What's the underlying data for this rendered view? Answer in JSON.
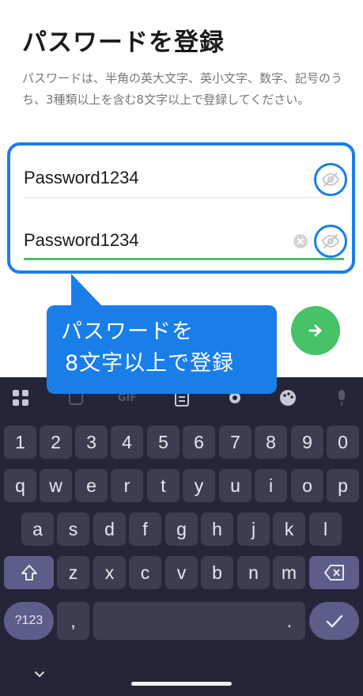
{
  "page": {
    "title": "パスワードを登録",
    "description": "パスワードは、半角の英大文字、英小文字、数字、記号のうち、3種類以上を含む8文字以上で登録してください。"
  },
  "fields": [
    {
      "value": "Password1234",
      "visibility_icon": "eye-off-icon"
    },
    {
      "value": "Password1234",
      "visibility_icon": "eye-off-icon",
      "clear_icon": "clear-icon"
    }
  ],
  "tooltip": {
    "line1": "パスワードを",
    "line2": "8文字以上で登録"
  },
  "next_button": {
    "icon": "arrow-right-icon"
  },
  "keyboard": {
    "toolbar": [
      "apps-grid-icon",
      "sticker-icon",
      "gif-icon",
      "clipboard-icon",
      "settings-gear-icon",
      "palette-icon",
      "microphone-icon"
    ],
    "row_numbers": [
      "1",
      "2",
      "3",
      "4",
      "5",
      "6",
      "7",
      "8",
      "9",
      "0"
    ],
    "row_top": [
      "q",
      "w",
      "e",
      "r",
      "t",
      "y",
      "u",
      "i",
      "o",
      "p"
    ],
    "row_middle": [
      "a",
      "s",
      "d",
      "f",
      "g",
      "h",
      "j",
      "k",
      "l"
    ],
    "row_bottom": [
      "z",
      "x",
      "c",
      "v",
      "b",
      "n",
      "m"
    ],
    "symbols_key": "?123",
    "comma_key": ",",
    "period_key": ".",
    "gif_label": "GIF"
  },
  "colors": {
    "accent": "#1a7ee8",
    "success": "#47c266",
    "keyboard_bg": "#242538"
  }
}
